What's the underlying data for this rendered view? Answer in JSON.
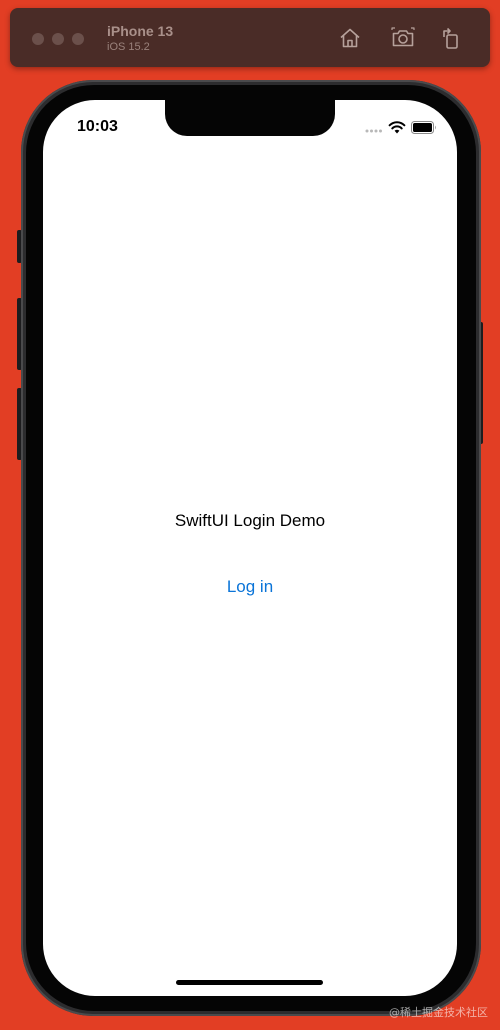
{
  "simulator": {
    "device_name": "iPhone 13",
    "os_version": "iOS 15.2",
    "toolbar": [
      {
        "icon": "home-icon"
      },
      {
        "icon": "screenshot-icon"
      },
      {
        "icon": "rotate-icon"
      }
    ]
  },
  "status_bar": {
    "time": "10:03",
    "icons": [
      "signal-icon",
      "wifi-icon",
      "battery-icon"
    ]
  },
  "main": {
    "title": "SwiftUI Login Demo",
    "login_label": "Log in"
  },
  "watermark": "@稀土掘金技术社区",
  "colors": {
    "desktop_background": "#e23e24",
    "toolbar_background": "#4a2c27",
    "link_blue": "#0a74d8"
  }
}
